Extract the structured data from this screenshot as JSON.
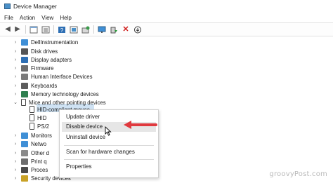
{
  "window": {
    "title": "Device Manager"
  },
  "menu": [
    "File",
    "Action",
    "View",
    "Help"
  ],
  "toolbar": [
    "back-icon",
    "forward-icon",
    "properties-icon",
    "help-icon",
    "update-driver-icon",
    "scan-icon",
    "monitor-icon",
    "enable-icon",
    "uninstall-icon",
    "download-icon"
  ],
  "tree": [
    {
      "label": "DellInstrumentation",
      "icon": "#3f8fd6",
      "expanded": false
    },
    {
      "label": "Disk drives",
      "icon": "#555555",
      "expanded": false
    },
    {
      "label": "Display adapters",
      "icon": "#2e6fb4",
      "expanded": false
    },
    {
      "label": "Firmware",
      "icon": "#6d6d6d",
      "expanded": false
    },
    {
      "label": "Human Interface Devices",
      "icon": "#7b7b7b",
      "expanded": false
    },
    {
      "label": "Keyboards",
      "icon": "#5c5c5c",
      "expanded": false
    },
    {
      "label": "Memory technology devices",
      "icon": "#2f7f4f",
      "expanded": false
    },
    {
      "label": "Mice and other pointing devices",
      "icon": "mouse",
      "expanded": true
    },
    {
      "label": "HID-compliant mouse",
      "icon": "mouse",
      "child": true,
      "selected": true
    },
    {
      "label": "HID",
      "icon": "mouse",
      "child": true
    },
    {
      "label": "PS/2",
      "icon": "mouse",
      "child": true
    },
    {
      "label": "Monitors",
      "icon": "#3f8fd6",
      "expanded": false
    },
    {
      "label": "Network",
      "icon": "#3f8fd6",
      "expanded": false
    },
    {
      "label": "Other devices",
      "icon": "#8a8a8a",
      "expanded": false
    },
    {
      "label": "Print queues",
      "icon": "#6d6d6d",
      "expanded": false
    },
    {
      "label": "Processors",
      "icon": "#4a4a4a",
      "expanded": false
    },
    {
      "label": "Security devices",
      "icon": "#c9a227",
      "expanded": false
    }
  ],
  "tree_display": {
    "monitors": "Monitors",
    "network": "Netwo",
    "other": "Other d",
    "print": "Print q",
    "processors": "Proces"
  },
  "context_menu": {
    "update": "Update driver",
    "disable": "Disable device",
    "uninstall": "Uninstall device",
    "scan": "Scan for hardware changes",
    "properties": "Properties"
  },
  "watermark": "groovyPost.com",
  "colors": {
    "highlight": "#cfe2f3",
    "arrow": "#e0393e"
  }
}
